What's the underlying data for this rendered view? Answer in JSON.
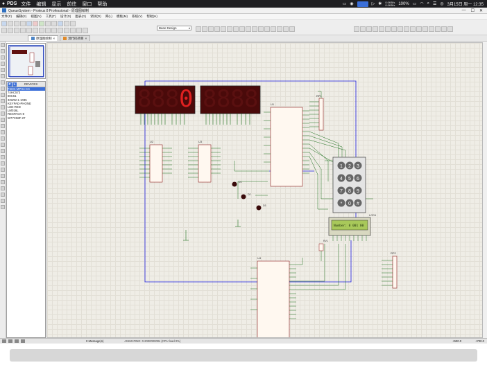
{
  "menubar": {
    "app_name": "PDS",
    "items": [
      "文件",
      "编辑",
      "显示",
      "前往",
      "窗口",
      "帮助"
    ],
    "net_up": "0.0KB/s",
    "net_down": "0.0KB/s",
    "battery": "100%",
    "datetime": "3月15日 周一 12:35"
  },
  "window": {
    "title": "QueueSystem - Proteus 8 Professional - 原理图绘制",
    "controls": [
      "—",
      "☐",
      "✕"
    ]
  },
  "appmenu": {
    "items": [
      "文件(F)",
      "编辑(E)",
      "视图(V)",
      "工具(T)",
      "设计(D)",
      "图表(G)",
      "调试(D)",
      "库(L)",
      "模板(M)",
      "系统(Y)",
      "帮助(H)"
    ]
  },
  "toolbar": {
    "design_select": "Base Design"
  },
  "tabs": [
    {
      "label": "原理图绘制",
      "active": true
    },
    {
      "label": "源代码项目",
      "active": false
    }
  ],
  "devices": {
    "header_label": "DEVICES",
    "buttons": [
      "P",
      "L"
    ],
    "items": [
      "7SEG-MPX4-CC",
      "74HC573",
      "80C51",
      "32WW-1-1035",
      "KEYPAD-PHONE",
      "LED-RED",
      "LM016L",
      "RESPACK-8",
      "W77C58F-27"
    ],
    "selected_index": 0
  },
  "schematic": {
    "display_left_digits": [
      "8",
      "8",
      "8",
      "0"
    ],
    "display_right_digits": [
      "8",
      "8",
      "8",
      "8"
    ],
    "keypad_keys": [
      "1",
      "2",
      "3",
      "4",
      "5",
      "6",
      "7",
      "8",
      "9",
      "*",
      "0",
      "#"
    ],
    "lcd_text": "Number: 0 001 00",
    "ref_u1": "U1",
    "ref_u2": "U2",
    "ref_u3": "U3",
    "ref_u4": "U4",
    "ref_rp1": "RP1",
    "ref_rp2": "RP2",
    "ref_lcd1": "LCD1",
    "ref_d1": "D1",
    "ref_d2": "D2",
    "ref_d3": "D3",
    "ref_rv1": "RV1"
  },
  "statusbar": {
    "message": "0 Message(s)",
    "animating": "ANIMATING: 0.200000000s (CPU load 0%)",
    "coord_x": "+500.0",
    "coord_y": "+700.0"
  },
  "colors": {
    "segment_on": "#e02020",
    "segment_off": "#5a1010",
    "lcd_bg": "#a8c85a",
    "wire": "#1a6e1a",
    "frame": "#1a1ae0",
    "chip_fill": "#fff8f0",
    "chip_border": "#8a1a1a"
  }
}
